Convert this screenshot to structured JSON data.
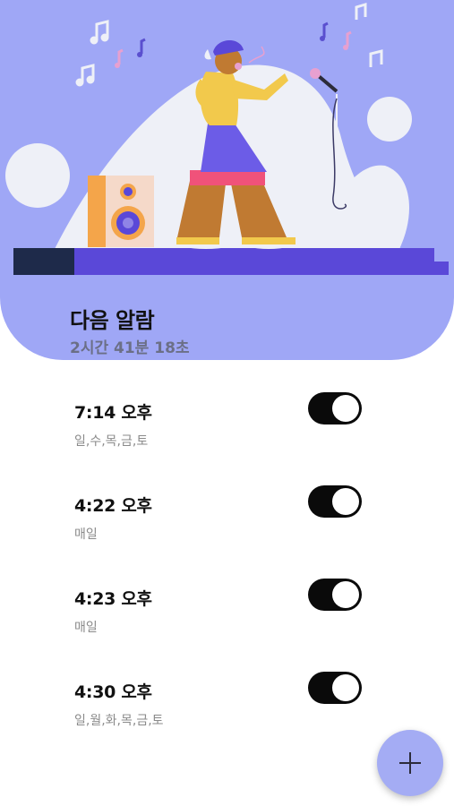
{
  "header": {
    "title": "다음 알람",
    "remaining": "2시간 41분 18초",
    "illustration": "singer-on-stage-illustration"
  },
  "alarms": [
    {
      "time": "7:14 오후",
      "days": "일,수,목,금,토",
      "enabled": true
    },
    {
      "time": "4:22 오후",
      "days": "매일",
      "enabled": true
    },
    {
      "time": "4:23 오후",
      "days": "매일",
      "enabled": true
    },
    {
      "time": "4:30 오후",
      "days": "일,월,화,목,금,토",
      "enabled": true
    }
  ],
  "fab": {
    "icon": "plus-icon"
  },
  "colors": {
    "hero_background": "#9fa7f6",
    "toggle_on": "#0a0a0a",
    "fab_background": "#a4acf4"
  }
}
